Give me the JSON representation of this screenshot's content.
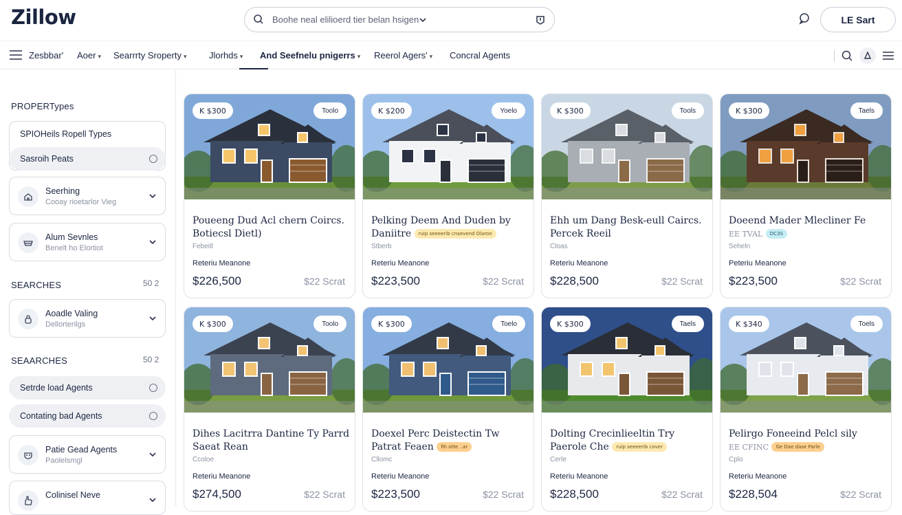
{
  "header": {
    "logo": "Zillow",
    "search_placeholder": "Boohe neal elilioerd tier belan hsigen",
    "signin_label": "LE Sart"
  },
  "nav": {
    "items": [
      {
        "label": "Zesbbar'",
        "dropdown": false
      },
      {
        "label": "Aoer",
        "dropdown": true
      },
      {
        "label": "Searrrty Sroperty",
        "dropdown": true
      },
      {
        "label": "Jlorhds",
        "dropdown": true
      },
      {
        "label": "And Seefnelu pnigerrs",
        "dropdown": true,
        "active": true
      },
      {
        "label": "Reerol Agers'",
        "dropdown": true
      },
      {
        "label": "Concral Agents",
        "dropdown": false
      }
    ]
  },
  "sidebar": {
    "property_heading": "PROPERTypes",
    "property_box_title": "SPIOHeils Ropell Types",
    "pills_top": [
      {
        "label": "Sasroih Peats"
      }
    ],
    "expanders_top": [
      {
        "title": "Seerhing",
        "sub": "Cooay rioetarlor Vieg",
        "icon": "home-icon"
      },
      {
        "title": "Alum Sevnles",
        "sub": "Benelt ho Elortiot",
        "icon": "bowl-icon"
      }
    ],
    "searches1": {
      "label": "SEARCHES",
      "count": "50  2"
    },
    "expander_mid": {
      "title": "Aoadle Valing",
      "sub": "Dellorterilgs",
      "icon": "lock-icon"
    },
    "searches2": {
      "label": "SEAARCHES",
      "count": "50  2"
    },
    "pills_bottom": [
      {
        "label": "Setrde load Agents"
      },
      {
        "label": "Contating bad Agents"
      }
    ],
    "expanders_bottom": [
      {
        "title": "Patie Gead Agents",
        "sub": "Paolelsmgl",
        "icon": "mask-icon"
      },
      {
        "title": "Colinisel Neve",
        "sub": "",
        "icon": "hand-icon"
      }
    ]
  },
  "cards": [
    {
      "price_tag": "K $300",
      "save": "Toolo",
      "title": "Poueeng Dud Acl chern Coircs. Botiecsl Dietl)",
      "chip": "",
      "meta": "Febeitl",
      "meta2": "Reteriu Meanone",
      "price": "$226,500",
      "unit": "$22 Scrat",
      "palette": "navy"
    },
    {
      "price_tag": "K $200",
      "save": "Yoelo",
      "title": "Pelking Deem And Duden by Daniitre",
      "chip": "ruip   seeeerib   cnsevend   Dlaron",
      "chip_color": "yellow",
      "meta": "Stberb",
      "meta2": "Reteriu Meanone",
      "price": "$223,500",
      "unit": "$22 Scrat",
      "palette": "white"
    },
    {
      "price_tag": "K $300",
      "save": "Tools",
      "title": "Ehh um Dang Besk-eull Caircs. Percek Reeil",
      "chip": "",
      "meta": "Cloas",
      "meta2": "Reteriu Meanone",
      "price": "$228,500",
      "unit": "$22 Scrat",
      "palette": "grey"
    },
    {
      "price_tag": "K $300",
      "save": "Taels",
      "title": "Doeend Mader Mlecliner Fe",
      "line2": "EE TVAL",
      "chip": "DC3S",
      "chip_color": "cyan",
      "meta": "Seheln",
      "meta2": "Peteriu Meanone",
      "price": "$223,500",
      "unit": "$22 Scrat",
      "palette": "brown"
    },
    {
      "price_tag": "K $300",
      "save": "Toolo",
      "title": "Dihes Lacitrra Dantine Ty Parrd Saeat Rean",
      "chip": "",
      "meta": "Ccoloe",
      "meta2": "Reteriu Meanone",
      "price": "$274,500",
      "unit": "$22 Scrat",
      "palette": "slate"
    },
    {
      "price_tag": "K $300",
      "save": "Toelo",
      "title": "Doexel Perc Deistectin Tw Patrat Feaen",
      "chip": "fih   otte   ..ar",
      "chip_color": "orange",
      "meta": "Cllomc",
      "meta2": "Reteriu Meanone",
      "price": "$223,500",
      "unit": "$22 Scrat",
      "palette": "blue"
    },
    {
      "price_tag": "K $300",
      "save": "Taels",
      "title": "Dolting Crecinlieeltin Try Paerole Che",
      "chip": "ruip   seeeerib   cover",
      "chip_color": "yellow",
      "meta": "Cerle",
      "meta2": "Reteriu Meanone",
      "price": "$228,500",
      "unit": "$22 Scrat",
      "palette": "dark"
    },
    {
      "price_tag": "K $340",
      "save": "Toels",
      "title": "Pelirgo Foneeind Pelcl sily",
      "line2": "EE CFINC",
      "chip": "Ge   Dae   dase   Parle",
      "chip_color": "orange",
      "meta": "Cplo",
      "meta2": "Reteriu Meanone",
      "price": "$228,504",
      "unit": "$22 Scrat",
      "palette": "light"
    }
  ],
  "colors": {
    "ink": "#1b2540",
    "accent": "#1b2540",
    "border": "#dfe2e8",
    "muted": "#8a91a2"
  }
}
